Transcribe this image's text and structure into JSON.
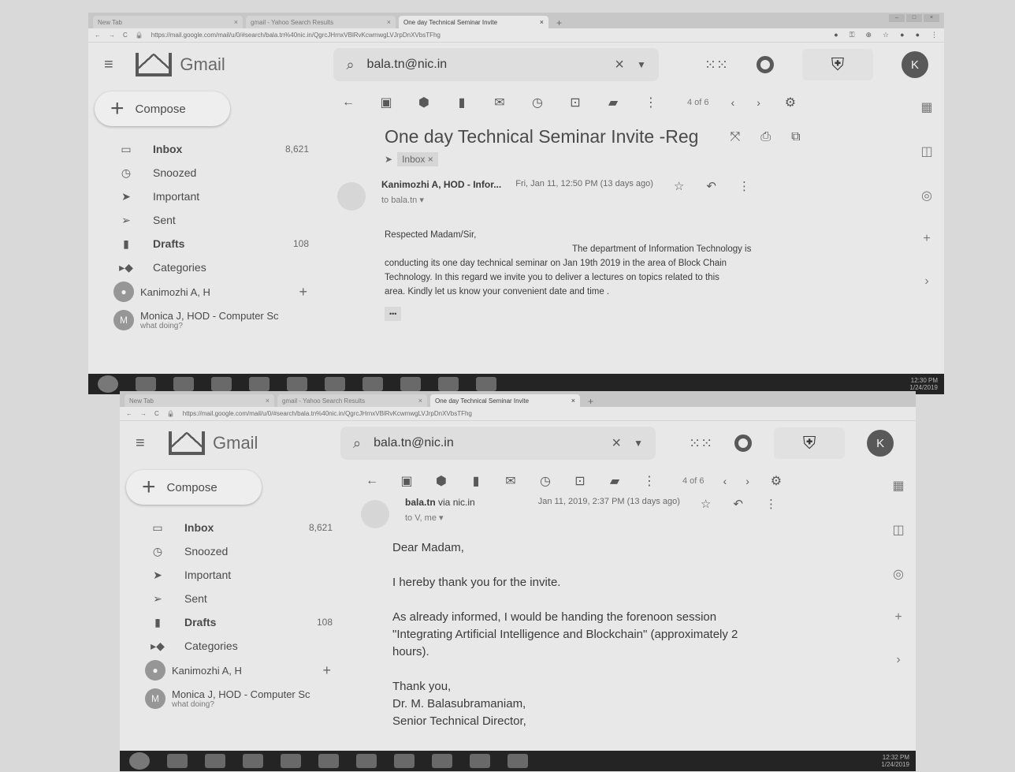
{
  "browser": {
    "tabs": [
      {
        "label": "New Tab"
      },
      {
        "label": "gmail - Yahoo Search Results"
      },
      {
        "label": "One day Technical Seminar Invite"
      }
    ],
    "url": "https://mail.google.com/mail/u/0/#search/bala.tn%40nic.in/QgrcJHrnxVBlRvKcwmwgLVJrpDnXVbsTFhg"
  },
  "gmail": {
    "app_name": "Gmail",
    "search_value": "bala.tn@nic.in",
    "avatar_letter": "K",
    "compose_label": "Compose",
    "nav": [
      {
        "label": "Inbox",
        "count": "8,621",
        "icon": "inbox-icon"
      },
      {
        "label": "Snoozed",
        "count": "",
        "icon": "clock-icon"
      },
      {
        "label": "Important",
        "count": "",
        "icon": "important-icon"
      },
      {
        "label": "Sent",
        "count": "",
        "icon": "send-icon"
      },
      {
        "label": "Drafts",
        "count": "108",
        "icon": "draft-icon"
      },
      {
        "label": "Categories",
        "count": "",
        "icon": "label-icon"
      }
    ],
    "hangouts": [
      {
        "name": "Kanimozhi A, H",
        "sub": ""
      },
      {
        "name": "Monica J, HOD - Computer Sc",
        "sub": "what doing?",
        "initial": "M"
      }
    ],
    "pager": "4 of 6"
  },
  "top": {
    "subject": "One day Technical Seminar Invite -Reg",
    "label_chip": "Inbox ×",
    "sender": "Kanimozhi A, HOD - Infor...",
    "to": "to bala.tn",
    "date": "Fri, Jan 11, 12:50 PM (13 days ago)",
    "greeting": "Respected  Madam/Sir,",
    "body_1": "The department of Information Technology is",
    "body_2": "conducting its one day technical seminar on Jan 19th 2019 in the area of Block Chain",
    "body_3": "Technology. In this regard we invite you to deliver a lectures on topics related to this",
    "body_4": "area. Kindly let us know your convenient date and time .",
    "more": "•••",
    "clock": "12:30 PM",
    "date_tray": "1/24/2019"
  },
  "bottom": {
    "sender": "bala.tn",
    "via": "via nic.in",
    "to": "to V, me",
    "date": "Jan 11, 2019, 2:37 PM (13 days ago)",
    "greeting": "Dear Madam,",
    "line_1": "I hereby thank you for the invite.",
    "line_2": "As already informed,  I would be handing the forenoon session",
    "line_3": "\"Integrating Artificial Intelligence and Blockchain\" (approximately 2",
    "line_4": "hours).",
    "sign_1": "Thank you,",
    "sign_2": "Dr. M. Balasubramaniam,",
    "sign_3": "Senior Technical Director,",
    "clock": "12:32 PM",
    "date_tray": "1/24/2019"
  }
}
